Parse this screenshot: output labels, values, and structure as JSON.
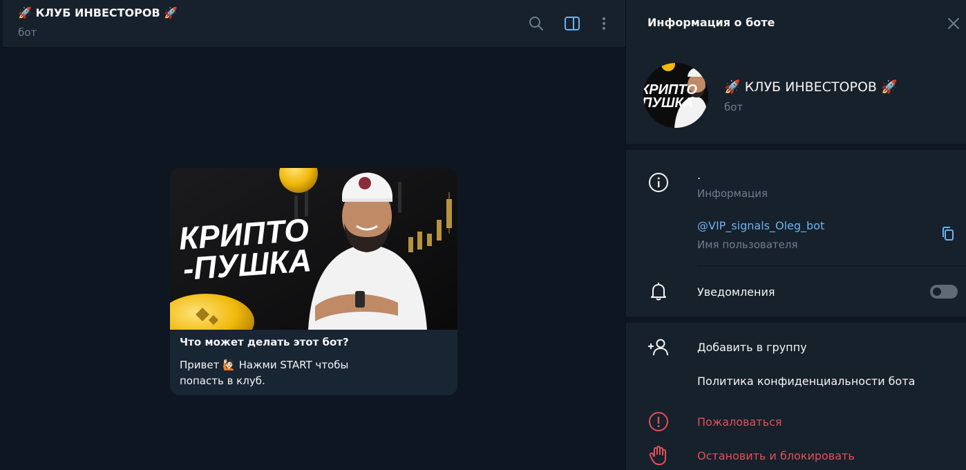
{
  "chat": {
    "title": "🚀 КЛУБ ИНВЕСТОРОВ 🚀",
    "subtitle": "бот",
    "icons": [
      "search-icon",
      "sidebar-toggle-icon",
      "more-vertical-icon"
    ]
  },
  "bot_card": {
    "image_text_line1": "КРИПТО",
    "image_text_line2": "-ПУШКА",
    "heading": "Что может делать этот бот?",
    "description_line1": "Привет 🙋🏻 Нажми START чтобы",
    "description_line2": "попасть в клуб."
  },
  "panel": {
    "title": "Информация о боте",
    "avatar_text_line1": "КРИПТО",
    "avatar_text_line2": "ПУШКА",
    "name": "🚀 КЛУБ ИНВЕСТОРОВ 🚀",
    "subtitle": "бот",
    "info_value": ".",
    "info_label": "Информация",
    "username_value": "@VIP_signals_Oleg_bot",
    "username_label": "Имя пользователя",
    "notifications_label": "Уведомления",
    "notifications_on": false,
    "add_to_group": "Добавить в группу",
    "privacy_policy": "Политика конфиденциальности бота",
    "report": "Пожаловаться",
    "stop_block": "Остановить и блокировать"
  },
  "colors": {
    "background": "#0e1621",
    "surface": "#17212b",
    "card": "#182533",
    "accent": "#6ab3f3",
    "muted": "#6d7f8f",
    "danger": "#e0505b"
  }
}
